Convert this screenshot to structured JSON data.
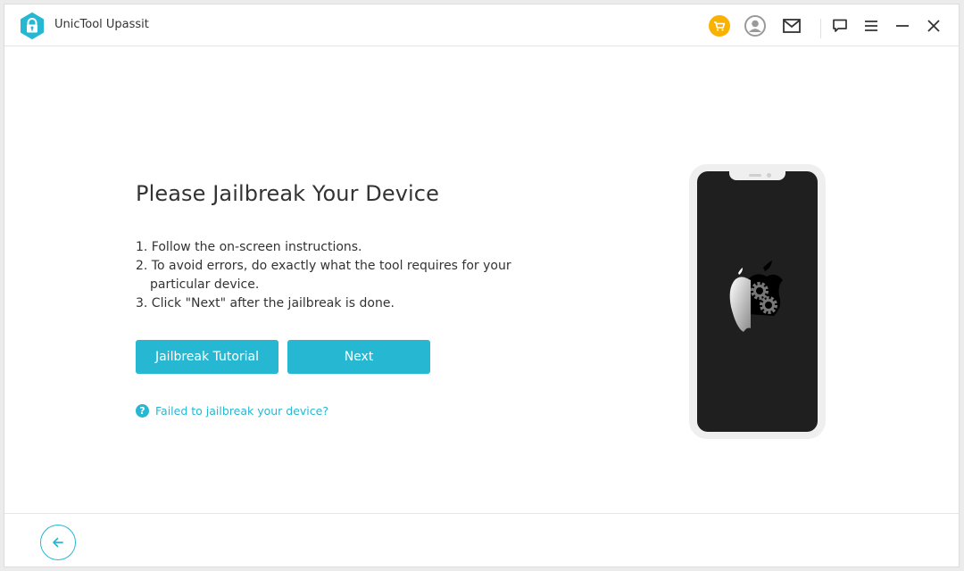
{
  "app": {
    "title": "UnicTool Upassit",
    "logo_icon": "lock-icon"
  },
  "titlebar": {
    "icons": [
      "cart-icon",
      "user-icon",
      "mail-icon",
      "feedback-icon",
      "menu-icon",
      "minimize-icon",
      "close-icon"
    ]
  },
  "main": {
    "heading": "Please Jailbreak Your Device",
    "steps": [
      "1. Follow the on-screen instructions.",
      "2. To avoid errors, do exactly what the tool requires for your particular device.",
      "3. Click \"Next\" after the jailbreak is done."
    ],
    "buttons": {
      "tutorial": "Jailbreak Tutorial",
      "next": "Next"
    },
    "help_link": "Failed to jailbreak your device?",
    "help_icon_glyph": "?"
  },
  "footer": {
    "back_icon": "arrow-left-icon"
  },
  "colors": {
    "accent": "#26b8d2",
    "cart": "#f9b200",
    "phone_screen": "#1f1f1f"
  }
}
